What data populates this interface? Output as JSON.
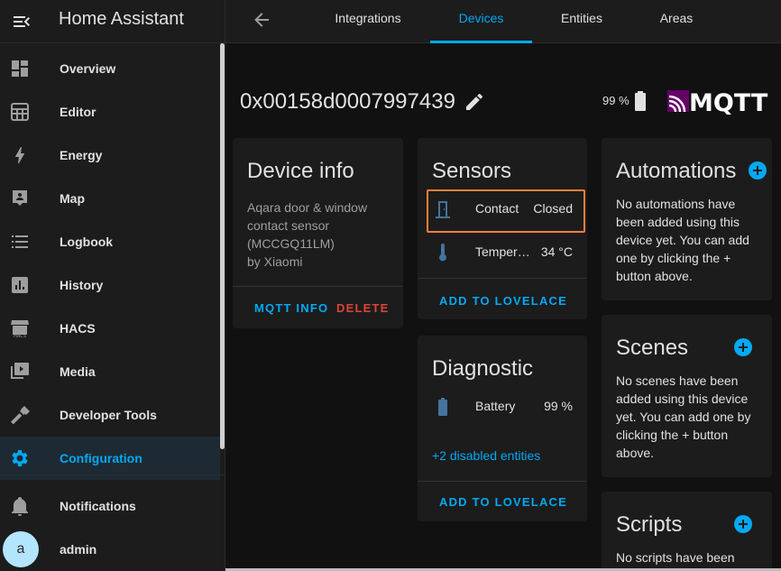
{
  "sidebar": {
    "title": "Home Assistant",
    "items": [
      {
        "label": "Overview",
        "icon": "overview-icon"
      },
      {
        "label": "Editor",
        "icon": "editor-icon"
      },
      {
        "label": "Energy",
        "icon": "lightning-icon"
      },
      {
        "label": "Map",
        "icon": "map-icon"
      },
      {
        "label": "Logbook",
        "icon": "logbook-icon"
      },
      {
        "label": "History",
        "icon": "history-icon"
      },
      {
        "label": "HACS",
        "icon": "hacs-icon",
        "icon_text": "HACS"
      },
      {
        "label": "Media",
        "icon": "media-icon"
      },
      {
        "label": "Developer Tools",
        "icon": "hammer-icon"
      },
      {
        "label": "Configuration",
        "icon": "gear-icon"
      }
    ],
    "notifications_label": "Notifications",
    "user_label": "admin",
    "avatar_letter": "a"
  },
  "topbar": {
    "tabs": [
      {
        "label": "Integrations"
      },
      {
        "label": "Devices"
      },
      {
        "label": "Entities"
      },
      {
        "label": "Areas"
      }
    ],
    "active_tab": "Devices"
  },
  "device": {
    "title": "0x00158d0007997439",
    "battery": "99 %",
    "integration_logo": "MQTT"
  },
  "device_info": {
    "title": "Device info",
    "model_line1": "Aqara door & window",
    "model_line2": "contact sensor",
    "model_line3": "(MCCGQ11LM)",
    "manufacturer": "by Xiaomi",
    "mqtt_info_btn": "MQTT INFO",
    "delete_btn": "DELETE"
  },
  "sensors": {
    "title": "Sensors",
    "entities": [
      {
        "name": "Contact",
        "value": "Closed",
        "icon": "door-icon"
      },
      {
        "name": "Temperature",
        "value": "34 °C",
        "icon": "thermometer-icon"
      }
    ],
    "add_btn": "ADD TO LOVELACE"
  },
  "diagnostic": {
    "title": "Diagnostic",
    "entities": [
      {
        "name": "Battery",
        "value": "99 %",
        "icon": "battery-icon"
      }
    ],
    "disabled_link": "+2 disabled entities",
    "add_btn": "ADD TO LOVELACE"
  },
  "automations": {
    "title": "Automations",
    "l1": "No automations have",
    "l2": "been added using this",
    "l3": "device yet. You can add",
    "l4": "one by clicking the +",
    "l5": "button above."
  },
  "scenes": {
    "title": "Scenes",
    "l1": "No scenes have been",
    "l2": "added using this device",
    "l3": "yet. You can add one by",
    "l4": "clicking the + button",
    "l5": "above."
  },
  "scripts": {
    "title": "Scripts",
    "l1": "No scripts have been"
  },
  "colors": {
    "accent": "#03a9f4",
    "delete": "#db4437",
    "highlight": "#ff7e3d",
    "mqtt_purple": "#660066"
  }
}
